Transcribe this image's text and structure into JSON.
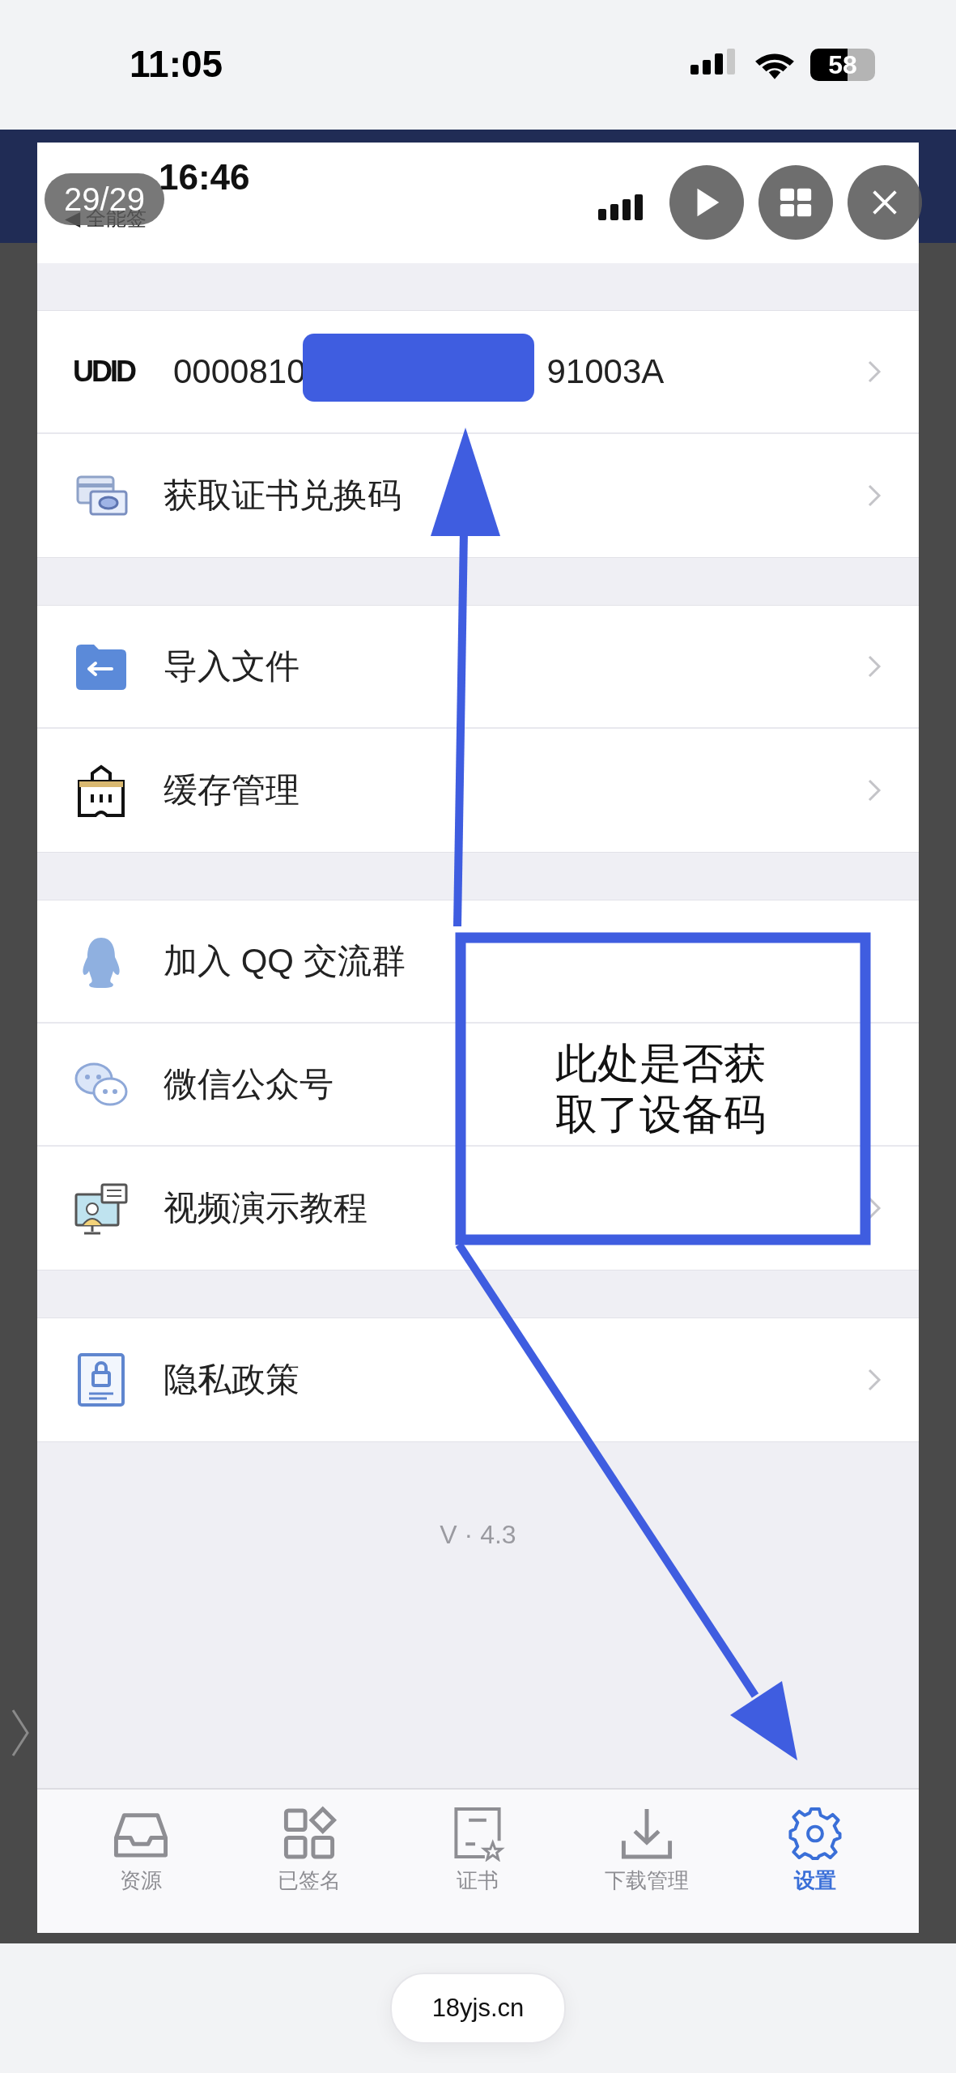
{
  "status_bar": {
    "time": "11:05",
    "battery": "58"
  },
  "viewer": {
    "counter": "29/29",
    "buttons": [
      {
        "kind": "play"
      },
      {
        "kind": "grid"
      },
      {
        "kind": "close"
      }
    ]
  },
  "screenshot": {
    "status": {
      "time": "16:46",
      "back_label": "◀ 全能签"
    },
    "groups": [
      [
        {
          "kind": "udid",
          "badge": "UDID",
          "value_start": "0000810",
          "value_end": "91003A",
          "chevron": true
        },
        {
          "kind": "link",
          "label": "获取证书兑换码",
          "chevron": true
        }
      ],
      [
        {
          "kind": "link",
          "label": "导入文件",
          "chevron": true
        },
        {
          "kind": "link",
          "label": "缓存管理",
          "chevron": true
        }
      ],
      [
        {
          "kind": "link",
          "label": "加入 QQ 交流群",
          "chevron": false
        },
        {
          "kind": "link",
          "label": "微信公众号",
          "chevron": false
        },
        {
          "kind": "link",
          "label": "视频演示教程",
          "chevron": true
        }
      ],
      [
        {
          "kind": "link",
          "label": "隐私政策",
          "chevron": true
        }
      ]
    ],
    "version": "V · 4.3",
    "tabs": [
      {
        "label": "资源",
        "selected": false
      },
      {
        "label": "已签名",
        "selected": false
      },
      {
        "label": "证书",
        "selected": false
      },
      {
        "label": "下载管理",
        "selected": false
      },
      {
        "label": "设置",
        "selected": true
      }
    ],
    "annotation": {
      "text": "此处是否获取了设备码"
    }
  },
  "browser": {
    "url": "18yjs.cn"
  }
}
